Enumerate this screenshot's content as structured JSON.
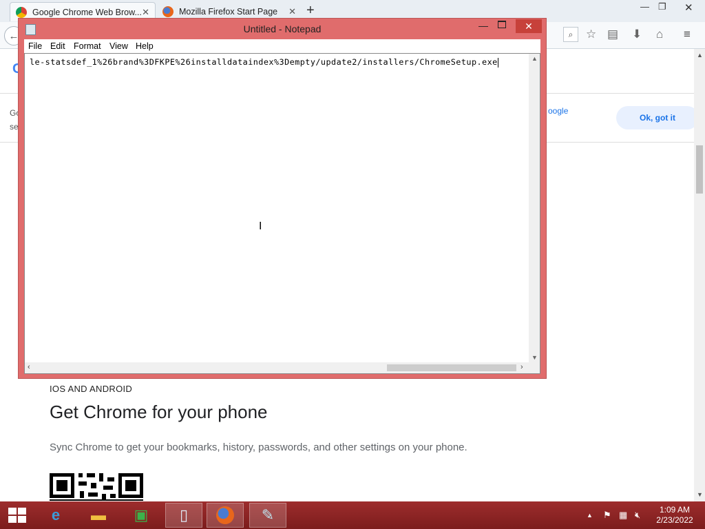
{
  "browser": {
    "tabs": [
      {
        "label": "Google Chrome Web Brow...",
        "active": true
      },
      {
        "label": "Mozilla Firefox Start Page",
        "active": false
      }
    ],
    "new_tab_label": "+"
  },
  "page": {
    "cookie_text_left_1": "Go",
    "cookie_text_left_2": "se",
    "cookie_text_right": "oogle",
    "ok_button": "Ok, got it",
    "section_label": "IOS AND ANDROID",
    "heading": "Get Chrome for your phone",
    "description": "Sync Chrome to get your bookmarks, history, passwords, and other settings on your phone."
  },
  "notepad": {
    "title": "Untitled - Notepad",
    "menu": [
      "File",
      "Edit",
      "Format",
      "View",
      "Help"
    ],
    "content": "le-statsdef_1%26brand%3DFKPE%26installdataindex%3Dempty/update2/installers/ChromeSetup.exe",
    "close_symbol": "✕"
  },
  "taskbar": {
    "time": "1:09 AM",
    "date": "2/23/2022"
  },
  "colors": {
    "notepad_frame": "#e06c6c",
    "taskbar": "#8b2323",
    "ok_button_bg": "#e8f0fe",
    "link_blue": "#1a73e8"
  }
}
